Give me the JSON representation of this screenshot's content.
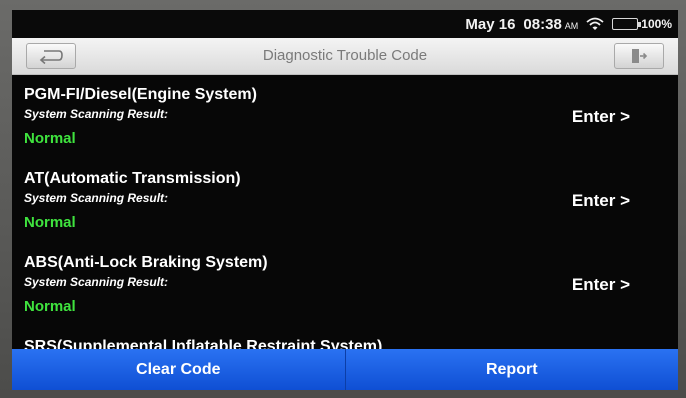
{
  "status_bar": {
    "date": "May 16",
    "time": "08:38",
    "ampm": "AM",
    "battery": "100%"
  },
  "header": {
    "title": "Diagnostic Trouble Code"
  },
  "systems": [
    {
      "name": "PGM-FI/Diesel(Engine System)",
      "subtitle": "System Scanning Result:",
      "status": "Normal",
      "action": "Enter >"
    },
    {
      "name": "AT(Automatic Transmission)",
      "subtitle": "System Scanning Result:",
      "status": "Normal",
      "action": "Enter >"
    },
    {
      "name": "ABS(Anti-Lock Braking System)",
      "subtitle": "System Scanning Result:",
      "status": "Normal",
      "action": "Enter >"
    },
    {
      "name": "SRS(Supplemental Inflatable Restraint System)"
    }
  ],
  "footer": {
    "clear_label": "Clear Code",
    "report_label": "Report"
  },
  "colors": {
    "status_normal": "#3fe33e",
    "button_blue": "#1a5ee0",
    "battery_green": "#39d13a"
  }
}
